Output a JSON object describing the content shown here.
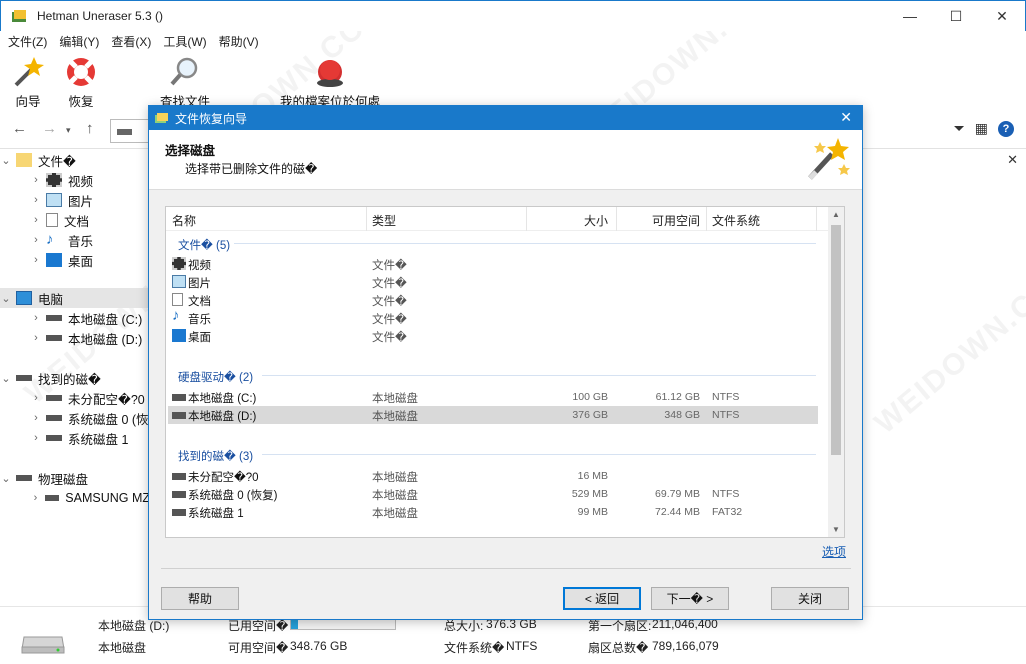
{
  "app": {
    "title": "Hetman Uneraser 5.3 ()"
  },
  "window_controls": {
    "minimize": "—",
    "maximize": "☐",
    "close": "✕"
  },
  "menu": [
    "文件(Z)",
    "编辑(Y)",
    "查看(X)",
    "工具(W)",
    "帮助(V)"
  ],
  "toolbar": {
    "wizard": "向导",
    "recover": "恢复",
    "find_file": "查找文件",
    "where_file": "我的檔案位於何處"
  },
  "tree": {
    "files": "文件�",
    "files_children": [
      "视频",
      "图片",
      "文档",
      "音乐",
      "桌面"
    ],
    "computer": "电脑",
    "computer_children": [
      "本地磁盘 (C:)",
      "本地磁盘 (D:)"
    ],
    "found": "找到的磁�",
    "found_children": [
      "未分配空�?0",
      "系统磁盘 0 (恢",
      "系统磁盘 1"
    ],
    "physical": "物理磁盘",
    "physical_children": [
      "SAMSUNG MZ"
    ]
  },
  "dialog": {
    "title": "文件恢复向导",
    "heading": "选择磁盘",
    "subheading": "选择带已删除文件的磁�",
    "columns": {
      "name": "名称",
      "type": "类型",
      "size": "大小",
      "free": "可用空间",
      "fs": "文件系统"
    },
    "groups": [
      {
        "label": "文件� (5)",
        "rows": [
          {
            "icon": "video-icon",
            "name": "视频",
            "type": "文件�",
            "size": "",
            "free": "",
            "fs": ""
          },
          {
            "icon": "image-icon",
            "name": "图片",
            "type": "文件�",
            "size": "",
            "free": "",
            "fs": ""
          },
          {
            "icon": "document-icon",
            "name": "文档",
            "type": "文件�",
            "size": "",
            "free": "",
            "fs": ""
          },
          {
            "icon": "music-icon",
            "name": "音乐",
            "type": "文件�",
            "size": "",
            "free": "",
            "fs": ""
          },
          {
            "icon": "desktop-icon",
            "name": "桌面",
            "type": "文件�",
            "size": "",
            "free": "",
            "fs": ""
          }
        ]
      },
      {
        "label": "硬盘驱动� (2)",
        "rows": [
          {
            "icon": "system-drive-icon",
            "name": "本地磁盘 (C:)",
            "type": "本地磁盘",
            "size": "100 GB",
            "free": "61.12 GB",
            "fs": "NTFS"
          },
          {
            "icon": "drive-icon",
            "name": "本地磁盘 (D:)",
            "type": "本地磁盘",
            "size": "376 GB",
            "free": "348 GB",
            "fs": "NTFS",
            "selected": true
          }
        ]
      },
      {
        "label": "找到的磁� (3)",
        "rows": [
          {
            "icon": "drive-icon",
            "name": "未分配空�?0",
            "type": "本地磁盘",
            "size": "16 MB",
            "free": "",
            "fs": ""
          },
          {
            "icon": "drive-icon",
            "name": "系统磁盘 0 (恢复)",
            "type": "本地磁盘",
            "size": "529 MB",
            "free": "69.79 MB",
            "fs": "NTFS"
          },
          {
            "icon": "drive-icon",
            "name": "系统磁盘 1",
            "type": "本地磁盘",
            "size": "99 MB",
            "free": "72.44 MB",
            "fs": "FAT32"
          }
        ]
      }
    ],
    "options": "选项",
    "buttons": {
      "help": "帮助",
      "back": "< 返回",
      "next": "下一� >",
      "close": "关闭"
    }
  },
  "status": {
    "name": "本地磁盘 (D:)",
    "type": "本地磁盘",
    "used_label": "已用空间�",
    "used_fraction": 0.07,
    "free_label": "可用空间�",
    "free_value": "348.76 GB",
    "total_label": "总大小:",
    "total_value": "376.3 GB",
    "fs_label": "文件系统�",
    "fs_value": "NTFS",
    "first_sector_label": "第一个扇区:",
    "first_sector_value": "211,046,400",
    "sector_count_label": "扇区总数�",
    "sector_count_value": "789,166,079"
  },
  "colors": {
    "accent": "#1979ca",
    "link": "#1a5fb4",
    "selection": "#d9d9d9"
  }
}
